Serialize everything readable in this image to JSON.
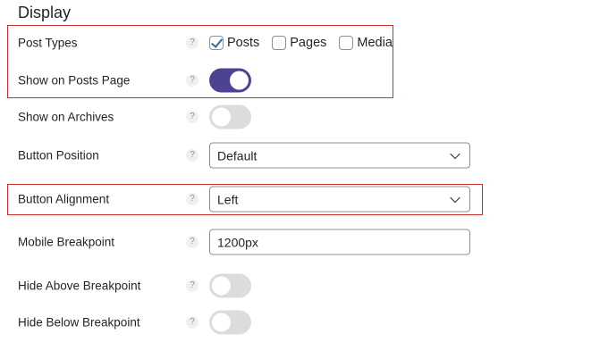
{
  "section": {
    "title": "Display"
  },
  "help_glyph": "?",
  "rows": {
    "post_types": {
      "label": "Post Types",
      "options": [
        {
          "label": "Posts",
          "checked": true
        },
        {
          "label": "Pages",
          "checked": false
        },
        {
          "label": "Media",
          "checked": false
        }
      ]
    },
    "show_on_posts_page": {
      "label": "Show on Posts Page",
      "enabled": true
    },
    "show_on_archives": {
      "label": "Show on Archives",
      "enabled": false
    },
    "button_position": {
      "label": "Button Position",
      "value": "Default"
    },
    "button_alignment": {
      "label": "Button Alignment",
      "value": "Left"
    },
    "mobile_breakpoint": {
      "label": "Mobile Breakpoint",
      "value": "1200px"
    },
    "hide_above_breakpoint": {
      "label": "Hide Above Breakpoint",
      "enabled": false
    },
    "hide_below_breakpoint": {
      "label": "Hide Below Breakpoint",
      "enabled": false
    }
  },
  "colors": {
    "toggle_on": "#4b4391",
    "toggle_off": "#dcdcde",
    "checkmark": "#2271b1",
    "highlight_border": "#c9302c"
  },
  "icons": {
    "help": "help-icon",
    "checkmark": "checkmark-icon",
    "dropdown": "chevron-down-icon"
  }
}
